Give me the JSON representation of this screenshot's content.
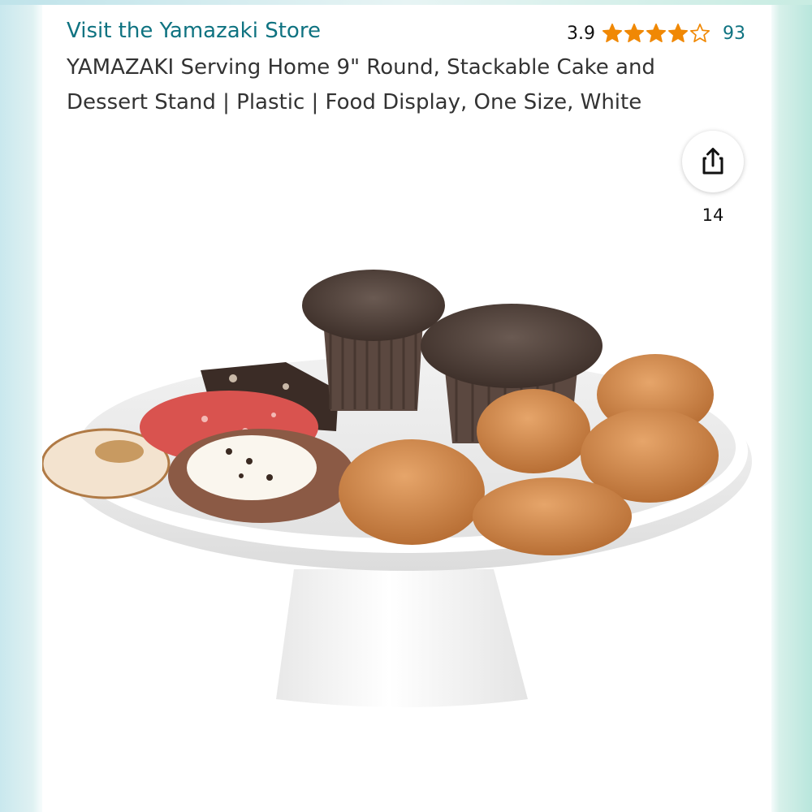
{
  "store": {
    "link_label": "Visit the Yamazaki Store"
  },
  "rating": {
    "value": "3.9",
    "stars": 3.9,
    "max_stars": 5,
    "count": "93",
    "star_color": "#f08804"
  },
  "product": {
    "title": "YAMAZAKI Serving Home 9\" Round, Stackable Cake and Dessert Stand | Plastic | Food Display, One Size, White"
  },
  "share": {
    "icon": "share-icon",
    "count": "14"
  },
  "colors": {
    "link": "#0f7381",
    "text": "#333333"
  }
}
